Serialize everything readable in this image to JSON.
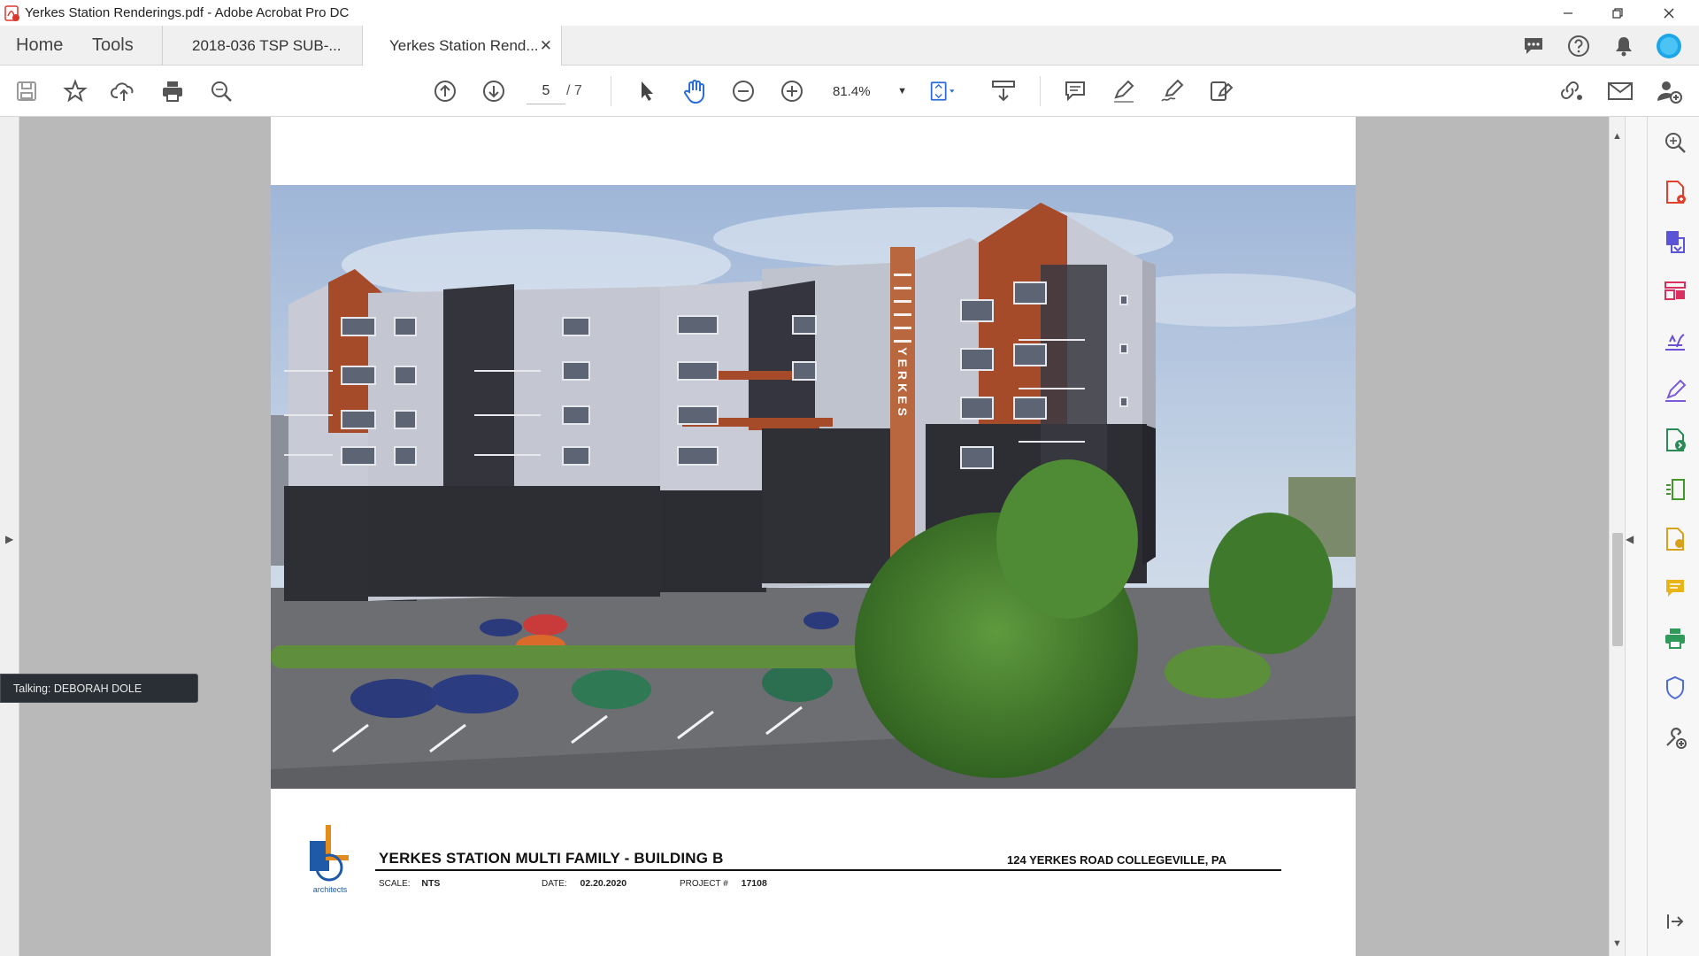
{
  "window": {
    "title": "Yerkes Station Renderings.pdf - Adobe Acrobat Pro DC"
  },
  "tabs": {
    "home": "Home",
    "tools": "Tools",
    "documents": [
      {
        "label": "2018-036 TSP SUB-...",
        "active": false
      },
      {
        "label": "Yerkes Station Rend...",
        "active": true
      }
    ],
    "close_glyph": "✕"
  },
  "toolbar": {
    "page_current": "5",
    "page_total": "/ 7",
    "zoom": "81.4%"
  },
  "document": {
    "project_title": "YERKES STATION MULTI FAMILY - BUILDING B",
    "address": "124 YERKES ROAD COLLEGEVILLE, PA",
    "scale_label": "SCALE:",
    "scale_value": "NTS",
    "date_label": "DATE:",
    "date_value": "02.20.2020",
    "project_label": "PROJECT #",
    "project_value": "17108",
    "logo_text": "architects",
    "building_sign": "YERKES B"
  },
  "talking": "Talking: DEBORAH DOLE",
  "colors": {
    "accent_blue": "#2b6cd6",
    "acrobat_red": "#d9382e",
    "brick": "#a64b2a",
    "siding_light": "#c9ccd6",
    "siding_dark": "#2f2f36"
  },
  "icons": {
    "right_panel": [
      "export-pdf-icon",
      "create-pdf-icon",
      "combine-files-icon",
      "organize-pages-icon",
      "fill-sign-icon",
      "edit-pdf-icon",
      "export-icon",
      "compress-icon",
      "protect-scan-icon",
      "comment-icon",
      "print-production-icon",
      "protect-icon",
      "more-tools-icon"
    ]
  }
}
